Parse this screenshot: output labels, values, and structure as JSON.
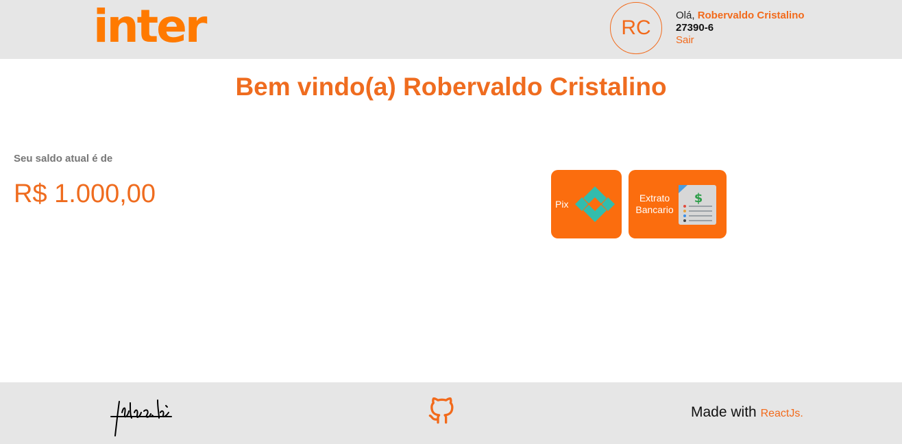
{
  "header": {
    "logo_text": "inter",
    "avatar_initials": "RC",
    "greeting": "Olá,",
    "user_name": "Robervaldo Cristalino",
    "account_number": "27390-6",
    "logout_label": "Sair"
  },
  "main": {
    "welcome_title": "Bem vindo(a) Robervaldo Cristalino",
    "balance_label": "Seu saldo atual é de",
    "balance_value": "R$ 1.000,00",
    "actions": [
      {
        "label": "Pix",
        "icon": "pix-icon"
      },
      {
        "label_line1": "Extrato",
        "label_line2": "Bancario",
        "icon": "bank-statement-icon"
      }
    ]
  },
  "footer": {
    "signature_icon": "signature-icon",
    "github_icon": "github-icon",
    "made_with_text": "Made with",
    "made_with_link": "ReactJs."
  },
  "colors": {
    "accent": "#f26a1b",
    "button": "#fb6d0e",
    "pix": "#32bcad",
    "bar": "#e6e6e6"
  }
}
